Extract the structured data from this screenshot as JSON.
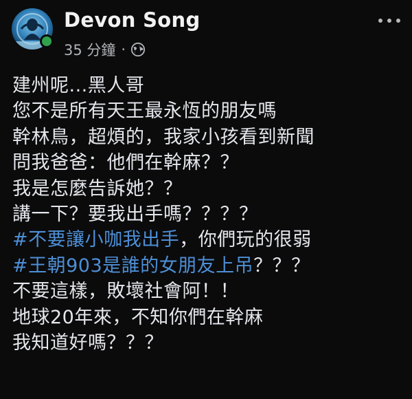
{
  "post": {
    "author": {
      "name": "Devon Song",
      "avatar_icon": "avatar-photo",
      "online": true,
      "online_color": "#31a24c"
    },
    "meta": {
      "time": "35 分鐘",
      "separator": "·",
      "audience_icon": "globe-icon"
    },
    "more_icon": "more-dots-icon",
    "hashtag_color": "#4d8fd6",
    "lines": [
      {
        "text": "建州呢...黑人哥"
      },
      {
        "text": "您不是所有天王最永恆的朋友嗎"
      },
      {
        "text": "幹林鳥，超煩的，我家小孩看到新聞"
      },
      {
        "text": "問我爸爸：他們在幹麻？？"
      },
      {
        "text": "我是怎麼告訴她？？"
      },
      {
        "text": "講一下？要我出手嗎？？？？"
      },
      {
        "hashtag": "#不要讓小咖我出手",
        "rest": "，你們玩的很弱"
      },
      {
        "hashtag": "#王朝903是誰的女朋友上吊",
        "rest": "？？？"
      },
      {
        "text": "不要這樣，敗壞社會阿！！"
      },
      {
        "text": "地球20年來，不知你們在幹麻"
      },
      {
        "text": "我知道好嗎？？？"
      }
    ]
  }
}
